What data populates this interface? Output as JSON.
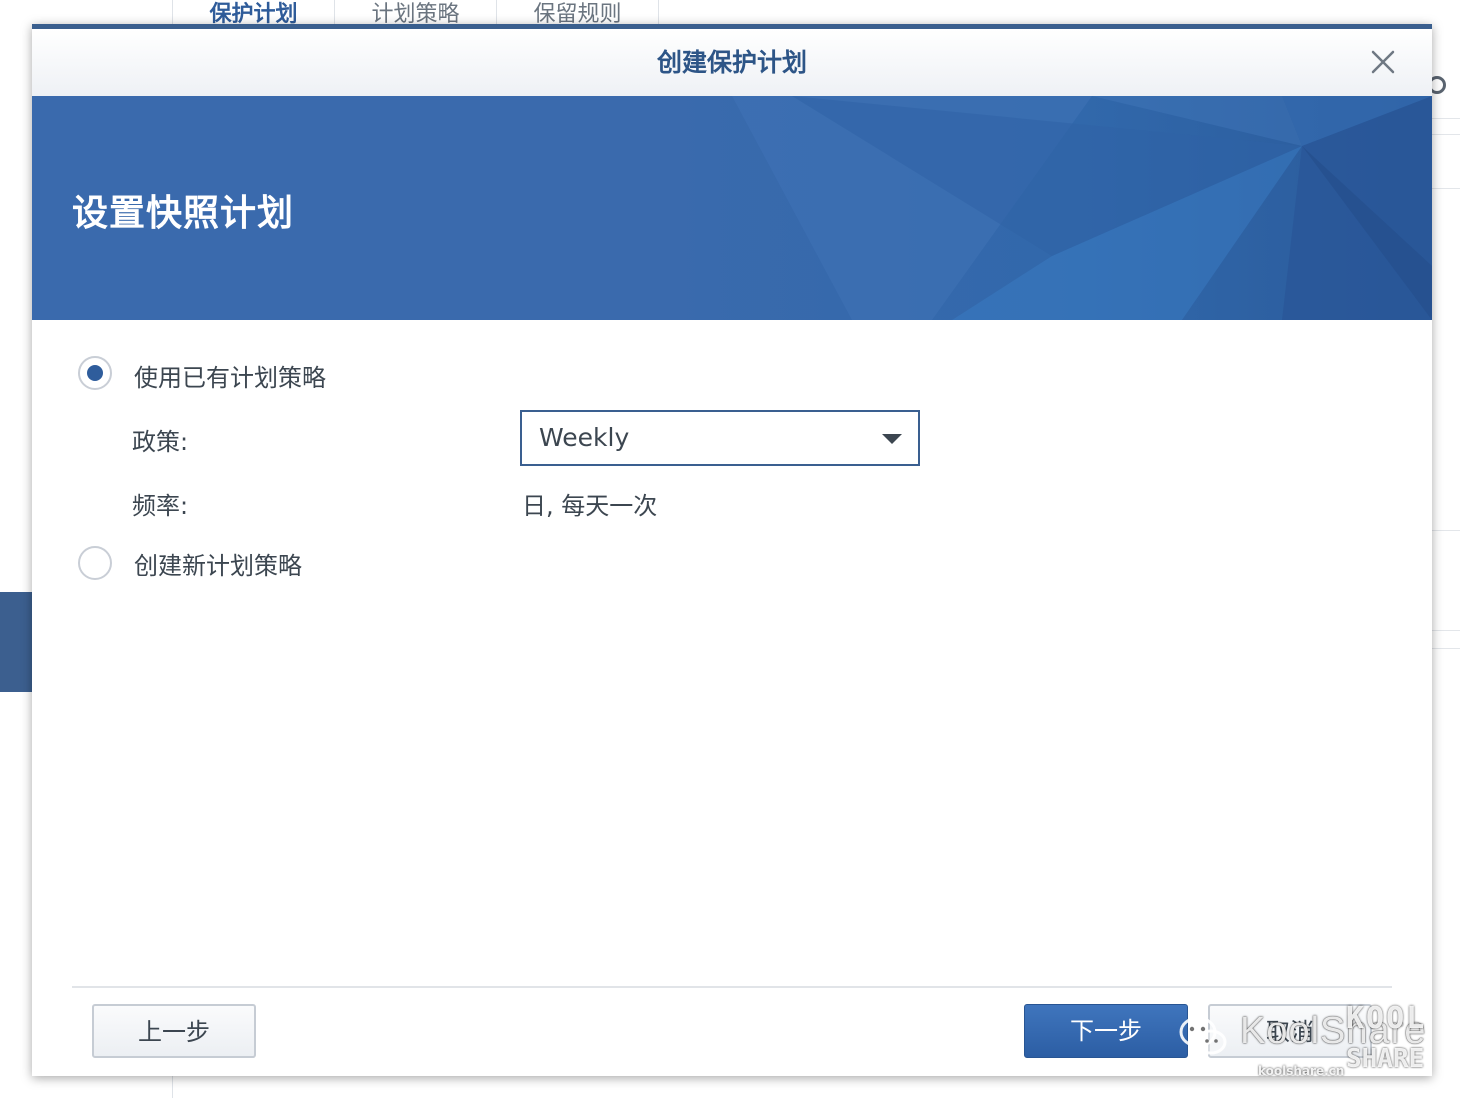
{
  "background": {
    "tabs": [
      {
        "label": "保护计划",
        "active": true
      },
      {
        "label": "计划策略",
        "active": false
      },
      {
        "label": "保留规则",
        "active": false
      }
    ]
  },
  "dialog": {
    "title": "创建保护计划",
    "banner_title": "设置快照计划",
    "options": {
      "use_existing": {
        "label": "使用已有计划策略",
        "selected": true
      },
      "create_new": {
        "label": "创建新计划策略",
        "selected": false
      }
    },
    "policy": {
      "label": "政策:",
      "selected_value": "Weekly"
    },
    "frequency": {
      "label": "频率:",
      "value": "日, 每天一次"
    },
    "buttons": {
      "prev": "上一步",
      "next": "下一步",
      "cancel": "取消"
    }
  },
  "watermark": {
    "text": "KoolShare",
    "sub": "koolshare.cn",
    "logo_top": "KOOL",
    "logo_bottom": "SHARE"
  },
  "colors": {
    "accent": "#2f5d9c",
    "banner": "#3a6aad",
    "title": "#2d5587"
  }
}
